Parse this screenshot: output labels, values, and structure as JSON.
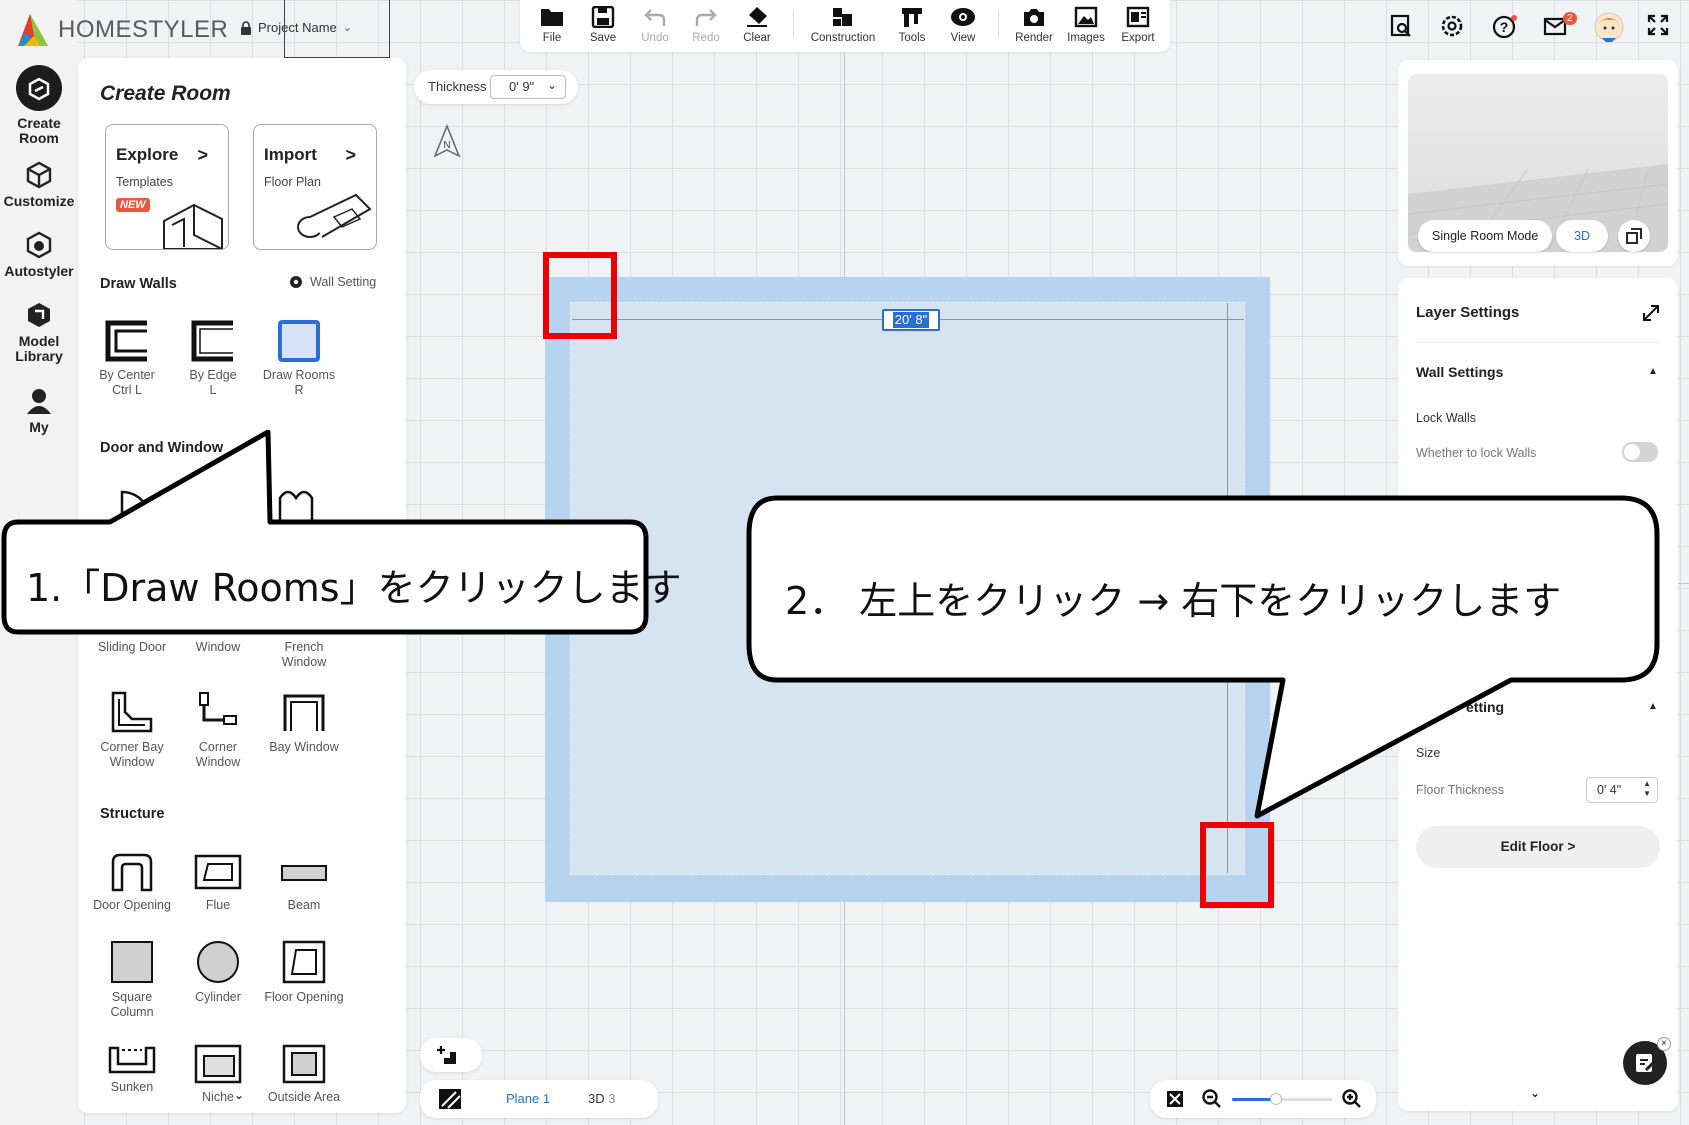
{
  "app": {
    "brand": "HOMESTYLER",
    "project_name": "Project Name"
  },
  "left_nav": [
    {
      "label1": "Create",
      "label2": "Room"
    },
    {
      "label1": "Customize",
      "label2": ""
    },
    {
      "label1": "Autostyler",
      "label2": ""
    },
    {
      "label1": "Model",
      "label2": "Library"
    },
    {
      "label1": "My",
      "label2": ""
    }
  ],
  "panel": {
    "title": "Create Room",
    "cards": [
      {
        "title": "Explore",
        "sub": "Templates",
        "badge": "NEW"
      },
      {
        "title": "Import",
        "sub": "Floor Plan"
      }
    ],
    "draw_walls": {
      "title": "Draw Walls",
      "setting": "Wall Setting",
      "tools": [
        {
          "label": "By Center",
          "key": "Ctrl L"
        },
        {
          "label": "By Edge",
          "key": "L"
        },
        {
          "label": "Draw Rooms",
          "key": "R"
        }
      ]
    },
    "door_window": {
      "title": "Door and Window",
      "row1": [
        "Sliding Door",
        "Window",
        "French Window"
      ],
      "row2": [
        "Corner Bay Window",
        "Corner Window",
        "Bay Window"
      ]
    },
    "structure": {
      "title": "Structure",
      "row1": [
        "Door Opening",
        "Flue",
        "Beam"
      ],
      "row2": [
        "Square Column",
        "Cylinder",
        "Floor Opening"
      ],
      "row3": [
        "Sunken",
        "Niche",
        "Outside Area"
      ]
    }
  },
  "toolbar": {
    "items": [
      "File",
      "Save",
      "Undo",
      "Redo",
      "Clear",
      "Construction",
      "Tools",
      "View",
      "Render",
      "Images",
      "Export"
    ]
  },
  "thickness": {
    "label": "Thickness",
    "value": "0' 9\""
  },
  "canvas": {
    "dimension": "20' 8\"",
    "compass": "N"
  },
  "mail_count": "2",
  "preview": {
    "single_room": "Single Room Mode",
    "mode_3d": "3D"
  },
  "layer_panel": {
    "title": "Layer Settings",
    "wall_settings": "Wall Settings",
    "lock_walls": "Lock Walls",
    "lock_walls_desc": "Whether to lock Walls",
    "floor_setting": "etting",
    "size": "Size",
    "floor_thickness_label": "Floor Thickness",
    "floor_thickness_value": "0' 4\"",
    "edit_floor": "Edit Floor"
  },
  "bottom": {
    "plane": "Plane",
    "plane_num": "1",
    "d3": "3D",
    "d3_num": "3"
  },
  "callouts": {
    "one": "1.「Draw Rooms」をクリックします",
    "two": "2．  左上をクリック → 右下をクリックします"
  }
}
